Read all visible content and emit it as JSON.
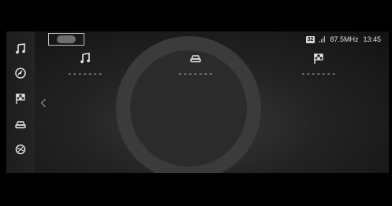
{
  "status_bar": {
    "badge": "32",
    "frequency": "87.5MHz",
    "time": "13:45"
  },
  "sidebar": {
    "items": [
      {
        "icon": "music-note-icon"
      },
      {
        "icon": "navigation-dial-icon"
      },
      {
        "icon": "checkered-flag-icon"
      },
      {
        "icon": "car-icon"
      },
      {
        "icon": "settings-icon"
      }
    ]
  },
  "columns": [
    {
      "icon": "music-note-icon",
      "value": "-------"
    },
    {
      "icon": "car-icon",
      "value": "-------"
    },
    {
      "icon": "checkered-flag-icon",
      "value": "-------"
    }
  ]
}
